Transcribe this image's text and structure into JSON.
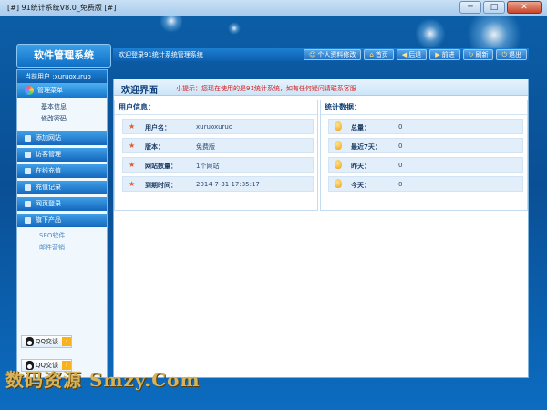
{
  "window": {
    "title": "[#] 91统计系统V8.0_免费版 [#]",
    "min_label": "─",
    "max_label": "□",
    "close_label": "✕"
  },
  "app": {
    "logo": "软件管理系统",
    "welcome": "欢迎登录91统计系统管理系统"
  },
  "nav": [
    {
      "label": "个人资料修改",
      "icon": "person-icon"
    },
    {
      "label": "首页",
      "icon": "home-icon"
    },
    {
      "label": "后退",
      "icon": "back-icon"
    },
    {
      "label": "前进",
      "icon": "forward-icon"
    },
    {
      "label": "刷新",
      "icon": "refresh-icon"
    },
    {
      "label": "退出",
      "icon": "exit-icon"
    }
  ],
  "sidebar": {
    "current_user": "当前用户 :xuruoxuruo",
    "mgmt_menu": "管理菜单",
    "sub_items": [
      "基本信息",
      "修改密码"
    ],
    "menu_items": [
      "添加网站",
      "访客管理",
      "在线充值",
      "充值记录",
      "网页登录",
      "旗下产品"
    ],
    "product_items": [
      "SEO软件",
      "邮件营销"
    ],
    "qq_buttons": [
      "QQ交谈",
      "QQ交谈"
    ]
  },
  "main": {
    "heading": "欢迎界面",
    "tip": "小提示：您现在使用的是91统计系统，如有任何疑问请联系客服",
    "user_info": {
      "title": "用户信息：",
      "rows": [
        {
          "label": "用户名：",
          "value": "xuruoxuruo"
        },
        {
          "label": "版本：",
          "value": "免费版"
        },
        {
          "label": "网站数量：",
          "value": "1个网站"
        },
        {
          "label": "到期时间：",
          "value": "2014-7-31 17:35:17"
        }
      ]
    },
    "stats": {
      "title": "统计数据：",
      "rows": [
        {
          "label": "总量：",
          "value": "0"
        },
        {
          "label": "最近7天：",
          "value": "0"
        },
        {
          "label": "昨天：",
          "value": "0"
        },
        {
          "label": "今天：",
          "value": "0"
        }
      ]
    }
  },
  "watermark": "数码资源 Smzy.Com"
}
